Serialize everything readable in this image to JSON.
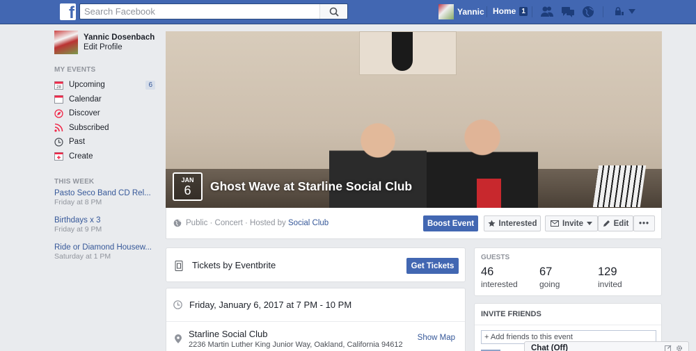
{
  "topbar": {
    "search_placeholder": "Search Facebook",
    "user_name": "Yannic",
    "home_label": "Home",
    "home_count": "1"
  },
  "sidebar": {
    "profile_name": "Yannic Dosenbach",
    "edit_profile": "Edit Profile",
    "my_events_title": "MY EVENTS",
    "calendar_icon_day": "28",
    "items": [
      {
        "label": "Upcoming",
        "badge": "6",
        "icon": "calendar-day-icon"
      },
      {
        "label": "Calendar",
        "icon": "calendar-icon"
      },
      {
        "label": "Discover",
        "icon": "compass-icon"
      },
      {
        "label": "Subscribed",
        "icon": "rss-icon"
      },
      {
        "label": "Past",
        "icon": "clock-icon"
      },
      {
        "label": "Create",
        "icon": "plus-calendar-icon"
      }
    ],
    "this_week_title": "THIS WEEK",
    "week_events": [
      {
        "title": "Pasto Seco Band CD Rel...",
        "time": "Friday at 8 PM"
      },
      {
        "title": "Birthdays x 3",
        "time": "Friday at 9 PM"
      },
      {
        "title": "Ride or Diamond Housew...",
        "time": "Saturday at 1 PM"
      }
    ]
  },
  "event": {
    "month": "JAN",
    "day": "6",
    "title": "Ghost Wave at Starline Social Club",
    "privacy": "Public · Concert · Hosted by",
    "host": "Social Club",
    "boost_label": "Boost Event",
    "interested_label": "Interested",
    "invite_label": "Invite",
    "edit_label": "Edit",
    "more_label": "•••"
  },
  "tickets": {
    "label": "Tickets by Eventbrite",
    "button": "Get Tickets"
  },
  "details": {
    "datetime": "Friday, January 6, 2017 at 7 PM - 10 PM",
    "venue": "Starline Social Club",
    "address": "2236 Martin Luther King Junior Way, Oakland, California 94612",
    "show_map": "Show Map"
  },
  "guests": {
    "title": "GUESTS",
    "stats": [
      {
        "count": "46",
        "label": "interested"
      },
      {
        "count": "67",
        "label": "going"
      },
      {
        "count": "129",
        "label": "invited"
      }
    ]
  },
  "invite_friends": {
    "title": "INVITE FRIENDS",
    "placeholder": "+ Add friends to this event"
  },
  "chat": {
    "label": "Chat (Off)"
  },
  "colors": {
    "brand_blue": "#4267b2",
    "link_blue": "#365899",
    "background": "#e9ebee"
  }
}
